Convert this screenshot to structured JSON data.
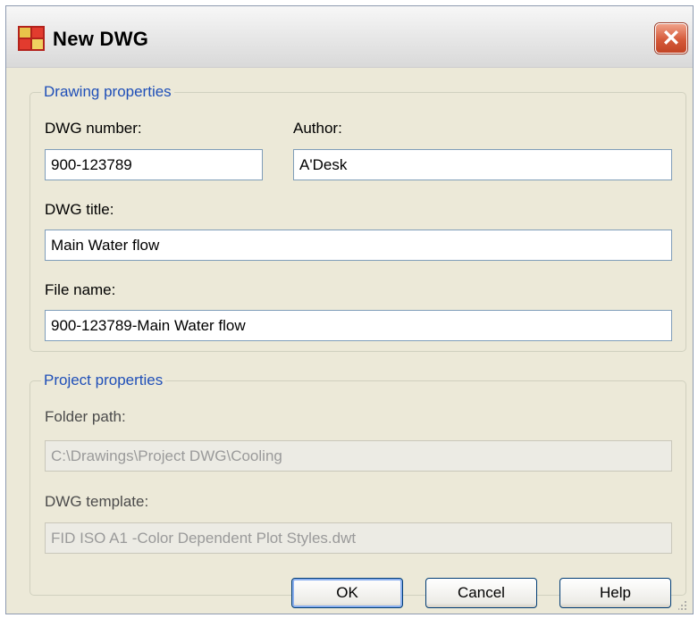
{
  "window": {
    "title": "New DWG",
    "close_glyph": "✕",
    "app_icon": "autocad-icon",
    "close_icon": "close-icon"
  },
  "drawing_properties": {
    "legend": "Drawing properties",
    "dwg_number": {
      "label": "DWG number:",
      "value": "900-123789"
    },
    "author": {
      "label": "Author:",
      "value": "A'Desk"
    },
    "dwg_title": {
      "label": "DWG title:",
      "value": "Main Water flow"
    },
    "file_name": {
      "label": "File name:",
      "value": "900-123789-Main Water flow"
    }
  },
  "project_properties": {
    "legend": "Project properties",
    "folder_path": {
      "label": "Folder path:",
      "value": "C:\\Drawings\\Project DWG\\Cooling"
    },
    "dwg_template": {
      "label": "DWG template:",
      "value": "FID ISO A1 -Color Dependent Plot Styles.dwt"
    }
  },
  "buttons": {
    "ok": "OK",
    "cancel": "Cancel",
    "help": "Help"
  },
  "colors": {
    "accent": "#1f4fb8",
    "close": "#d55a3a",
    "face": "#ece9d8"
  }
}
